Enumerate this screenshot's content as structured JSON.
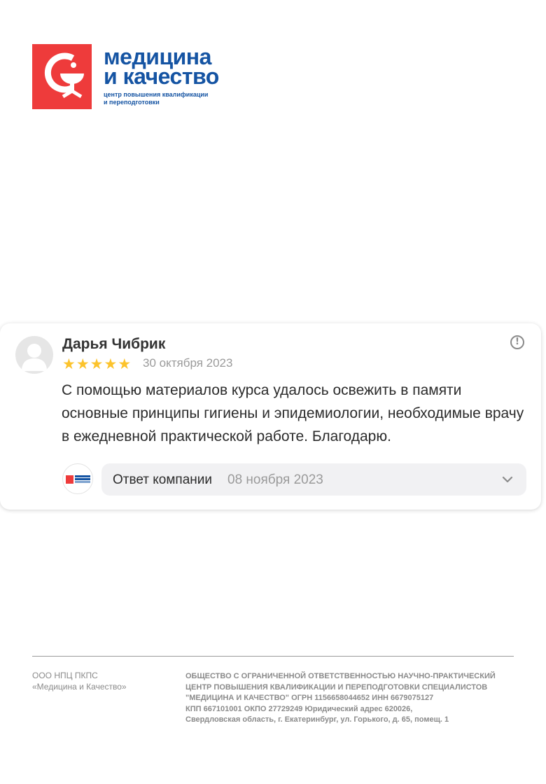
{
  "colors": {
    "brand_red": "#ee3b3b",
    "brand_blue": "#1554a3",
    "star": "#fcc32c",
    "muted": "#9a9a9a"
  },
  "logo": {
    "title_line1": "медицина",
    "title_line2": "и качество",
    "subtitle_line1": "центр повышения квалификации",
    "subtitle_line2": "и переподготовки"
  },
  "review": {
    "author": "Дарья Чибрик",
    "rating": 5,
    "date": "30 октября 2023",
    "text": "С помощью материалов курса удалось освежить в памяти основные принципы гигиены и эпидемиологии, необходимые врачу в ежедневной практической работе. Благодарю.",
    "report_icon": "alert-circle-icon",
    "reply": {
      "label": "Ответ компании",
      "date": "08 ноября 2023",
      "expand_icon": "chevron-down-icon"
    }
  },
  "footer": {
    "left_line1": "ООО НПЦ ПКПС",
    "left_line2": "«Медицина и Качество»",
    "right_lines": [
      "ОБЩЕСТВО С ОГРАНИЧЕННОЙ ОТВЕТСТВЕННОСТЬЮ НАУЧНО-ПРАКТИЧЕСКИЙ",
      "ЦЕНТР ПОВЫШЕНИЯ КВАЛИФИКАЦИИ И ПЕРЕПОДГОТОВКИ СПЕЦИАЛИСТОВ",
      "\"МЕДИЦИНА И КАЧЕСТВО\" ОГРН 1156658044652   ИНН 6679075127",
      "КПП 667101001   ОКПО 27729249  Юридический адрес 620026,",
      "Свердловская область, г. Екатеринбург, ул. Горького, д. 65, помещ. 1"
    ]
  }
}
